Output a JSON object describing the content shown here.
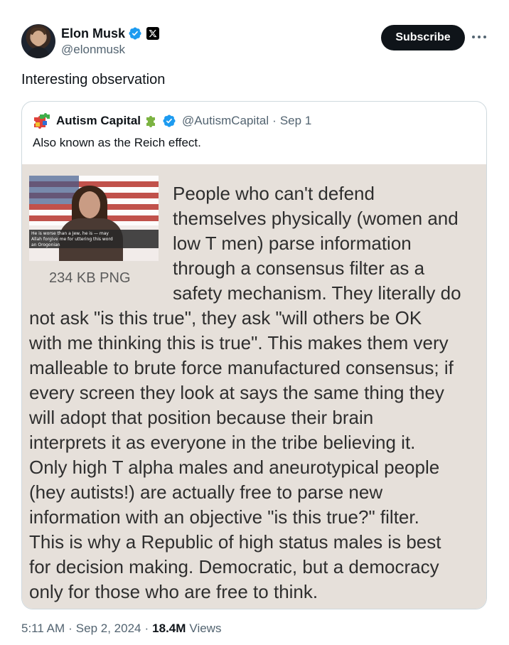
{
  "author": {
    "display_name": "Elon Musk",
    "handle": "@elonmusk",
    "subscribe_label": "Subscribe"
  },
  "tweet": {
    "text": "Interesting observation"
  },
  "quoted": {
    "display_name": "Autism Capital",
    "handle": "@AutismCapital",
    "date": "Sep 1",
    "text": "Also known as the Reich effect.",
    "thumbnail_caption": [
      "He is worse than a Jew, he is — may",
      "Allah forgive me for uttering this word",
      "an Orogonian"
    ],
    "file_size": "234 KB PNG",
    "meme_lines": [
      "People who can't defend",
      "themselves physically (women and",
      "low T men) parse information",
      "through a consensus filter as a",
      "safety mechanism. They literally do",
      "not ask \"is this true\", they ask \"will others be OK",
      "with me thinking this is true\". This makes them very",
      "malleable to brute force manufactured consensus; if",
      "every screen they look at says the same thing they",
      "will adopt that position because their brain",
      "interprets it as everyone in the tribe believing it.",
      "Only high T alpha males and aneurotypical people",
      "(hey autists!) are actually free to parse new",
      "information with an objective \"is this true?\" filter.",
      "This is why a Republic of high status males is best",
      "for decision making. Democratic, but a democracy",
      "only for those who are free to think."
    ]
  },
  "footer": {
    "time": "5:11 AM",
    "sep1": "·",
    "date": "Sep 2, 2024",
    "sep2": "·",
    "views_count": "18.4M",
    "views_label": "Views"
  },
  "colors": {
    "verified_blue": "#1d9bf0",
    "text_primary": "#0f1419",
    "text_secondary": "#536471",
    "meme_background": "#e6e0da"
  }
}
